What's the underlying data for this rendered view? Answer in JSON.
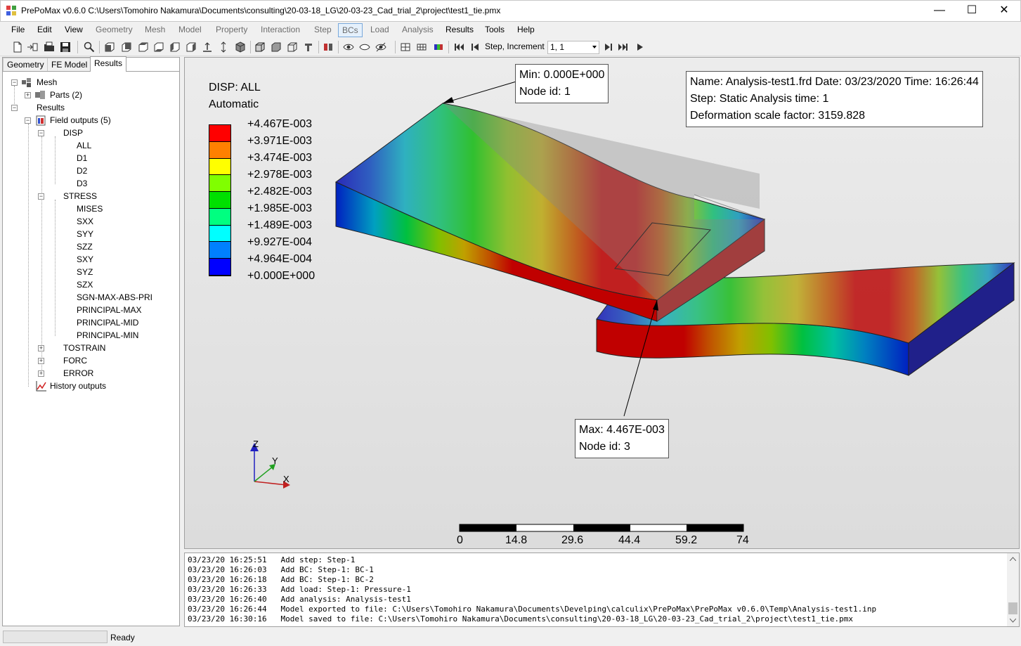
{
  "window": {
    "title": "PrePoMax v0.6.0  C:\\Users\\Tomohiro Nakamura\\Documents\\consulting\\20-03-18_LG\\20-03-23_Cad_trial_2\\project\\test1_tie.pmx",
    "minimize": "—",
    "maximize": "☐",
    "close": "✕"
  },
  "menu": [
    {
      "label": "File",
      "enabled": true
    },
    {
      "label": "Edit",
      "enabled": true
    },
    {
      "label": "View",
      "enabled": true
    },
    {
      "label": "Geometry",
      "enabled": false
    },
    {
      "label": "Mesh",
      "enabled": false
    },
    {
      "label": "Model",
      "enabled": false
    },
    {
      "label": "Property",
      "enabled": false
    },
    {
      "label": "Interaction",
      "enabled": false
    },
    {
      "label": "Step",
      "enabled": false
    },
    {
      "label": "BCs",
      "enabled": false
    },
    {
      "label": "Load",
      "enabled": false
    },
    {
      "label": "Analysis",
      "enabled": false
    },
    {
      "label": "Results",
      "enabled": true
    },
    {
      "label": "Tools",
      "enabled": true
    },
    {
      "label": "Help",
      "enabled": true
    }
  ],
  "toolbar": {
    "step_label": "Step, Increment",
    "step_value": "1, 1"
  },
  "tabs": [
    "Geometry",
    "FE Model",
    "Results"
  ],
  "tree": {
    "mesh": "Mesh",
    "parts": "Parts (2)",
    "results": "Results",
    "field_outputs": "Field outputs (5)",
    "disp": "DISP",
    "disp_items": [
      "ALL",
      "D1",
      "D2",
      "D3"
    ],
    "stress": "STRESS",
    "stress_items": [
      "MISES",
      "SXX",
      "SYY",
      "SZZ",
      "SXY",
      "SYZ",
      "SZX",
      "SGN-MAX-ABS-PRI",
      "PRINCIPAL-MAX",
      "PRINCIPAL-MID",
      "PRINCIPAL-MIN"
    ],
    "tostrain": "TOSTRAIN",
    "forc": "FORC",
    "error": "ERROR",
    "history_outputs": "History outputs"
  },
  "viewport": {
    "legend_title": "DISP: ALL",
    "legend_mode": "Automatic",
    "legend_values": [
      "+4.467E-003",
      "+3.971E-003",
      "+3.474E-003",
      "+2.978E-003",
      "+2.482E-003",
      "+1.985E-003",
      "+1.489E-003",
      "+9.927E-004",
      "+4.964E-004",
      "+0.000E+000"
    ],
    "legend_colors": [
      "#ff0000",
      "#ff8000",
      "#ffff00",
      "#80ff00",
      "#00e000",
      "#00ff80",
      "#00ffff",
      "#0080ff",
      "#0000ff"
    ],
    "info_line1": "Name: Analysis-test1.frd   Date: 03/23/2020   Time: 16:26:44",
    "info_line2": "Step: Static   Analysis time: 1",
    "info_line3": "Deformation scale factor: 3159.828",
    "min_line1": "Min: 0.000E+000",
    "min_line2": "Node id: 1",
    "max_line1": "Max: 4.467E-003",
    "max_line2": "Node id: 3",
    "axis_x": "X",
    "axis_y": "Y",
    "axis_z": "Z",
    "scale_labels": [
      "0",
      "14.8",
      "29.6",
      "44.4",
      "59.2",
      "74"
    ]
  },
  "log": [
    "03/23/20 16:25:51   Add step: Step-1",
    "03/23/20 16:26:03   Add BC: Step-1: BC-1",
    "03/23/20 16:26:18   Add BC: Step-1: BC-2",
    "03/23/20 16:26:33   Add load: Step-1: Pressure-1",
    "03/23/20 16:26:40   Add analysis: Analysis-test1",
    "03/23/20 16:26:44   Model exported to file: C:\\Users\\Tomohiro Nakamura\\Documents\\Develping\\calculix\\PrePoMax\\PrePoMax v0.6.0\\Temp\\Analysis-test1.inp",
    "03/23/20 16:30:16   Model saved to file: C:\\Users\\Tomohiro Nakamura\\Documents\\consulting\\20-03-18_LG\\20-03-23_Cad_trial_2\\project\\test1_tie.pmx"
  ],
  "status": {
    "text": "Ready"
  }
}
